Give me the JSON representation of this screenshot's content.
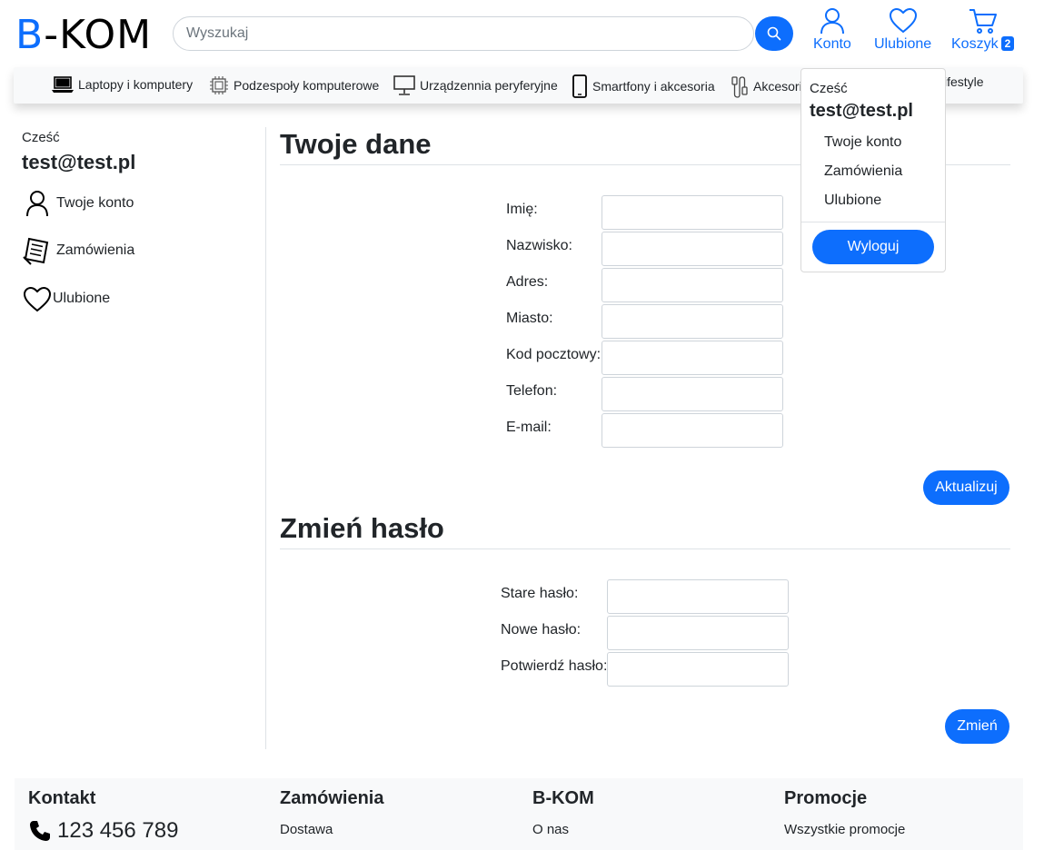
{
  "header": {
    "logo_b": "B",
    "logo_rest": "-KOM",
    "search_placeholder": "Wyszukaj",
    "account_label": "Konto",
    "favorites_label": "Ulubione",
    "cart_label": "Koszyk",
    "cart_count": "2"
  },
  "categories": [
    {
      "label": "Laptopy i komputery",
      "icon": "laptop-icon"
    },
    {
      "label": "Podzespoły komputerowe",
      "icon": "cpu-icon"
    },
    {
      "label": "Urządzennia peryferyjne",
      "icon": "monitor-icon"
    },
    {
      "label": "Smartfony i akcesoria",
      "icon": "smartphone-icon"
    },
    {
      "label": "Akcesori",
      "icon": "cable-icon"
    },
    {
      "label": "ifestyle",
      "icon": ""
    }
  ],
  "dropdown": {
    "greeting": "Cześć",
    "email": "test@test.pl",
    "items": [
      "Twoje konto",
      "Zamówienia",
      "Ulubione"
    ],
    "logout_label": "Wyloguj"
  },
  "sidebar": {
    "greeting": "Cześć",
    "email": "test@test.pl",
    "items": [
      {
        "label": "Twoje konto",
        "icon": "person-icon"
      },
      {
        "label": "Zamówienia",
        "icon": "receipt-icon"
      },
      {
        "label": "Ulubione",
        "icon": "heart-icon"
      }
    ]
  },
  "profile": {
    "title": "Twoje dane",
    "fields": [
      "Imię:",
      "Nazwisko:",
      "Adres:",
      "Miasto:",
      "Kod pocztowy:",
      "Telefon:",
      "E-mail:"
    ],
    "submit_label": "Aktualizuj"
  },
  "password": {
    "title": "Zmień hasło",
    "fields": [
      "Stare hasło:",
      "Nowe hasło:",
      "Potwierdź hasło:"
    ],
    "submit_label": "Zmień"
  },
  "footer": {
    "columns": [
      {
        "heading": "Kontakt",
        "link": "123 456 789"
      },
      {
        "heading": "Zamówienia",
        "link": "Dostawa"
      },
      {
        "heading": "B-KOM",
        "link": "O nas"
      },
      {
        "heading": "Promocje",
        "link": "Wszystkie promocje"
      }
    ]
  },
  "colors": {
    "accent": "#0d6efd",
    "text": "#212529",
    "bar": "#f8f9fa"
  }
}
